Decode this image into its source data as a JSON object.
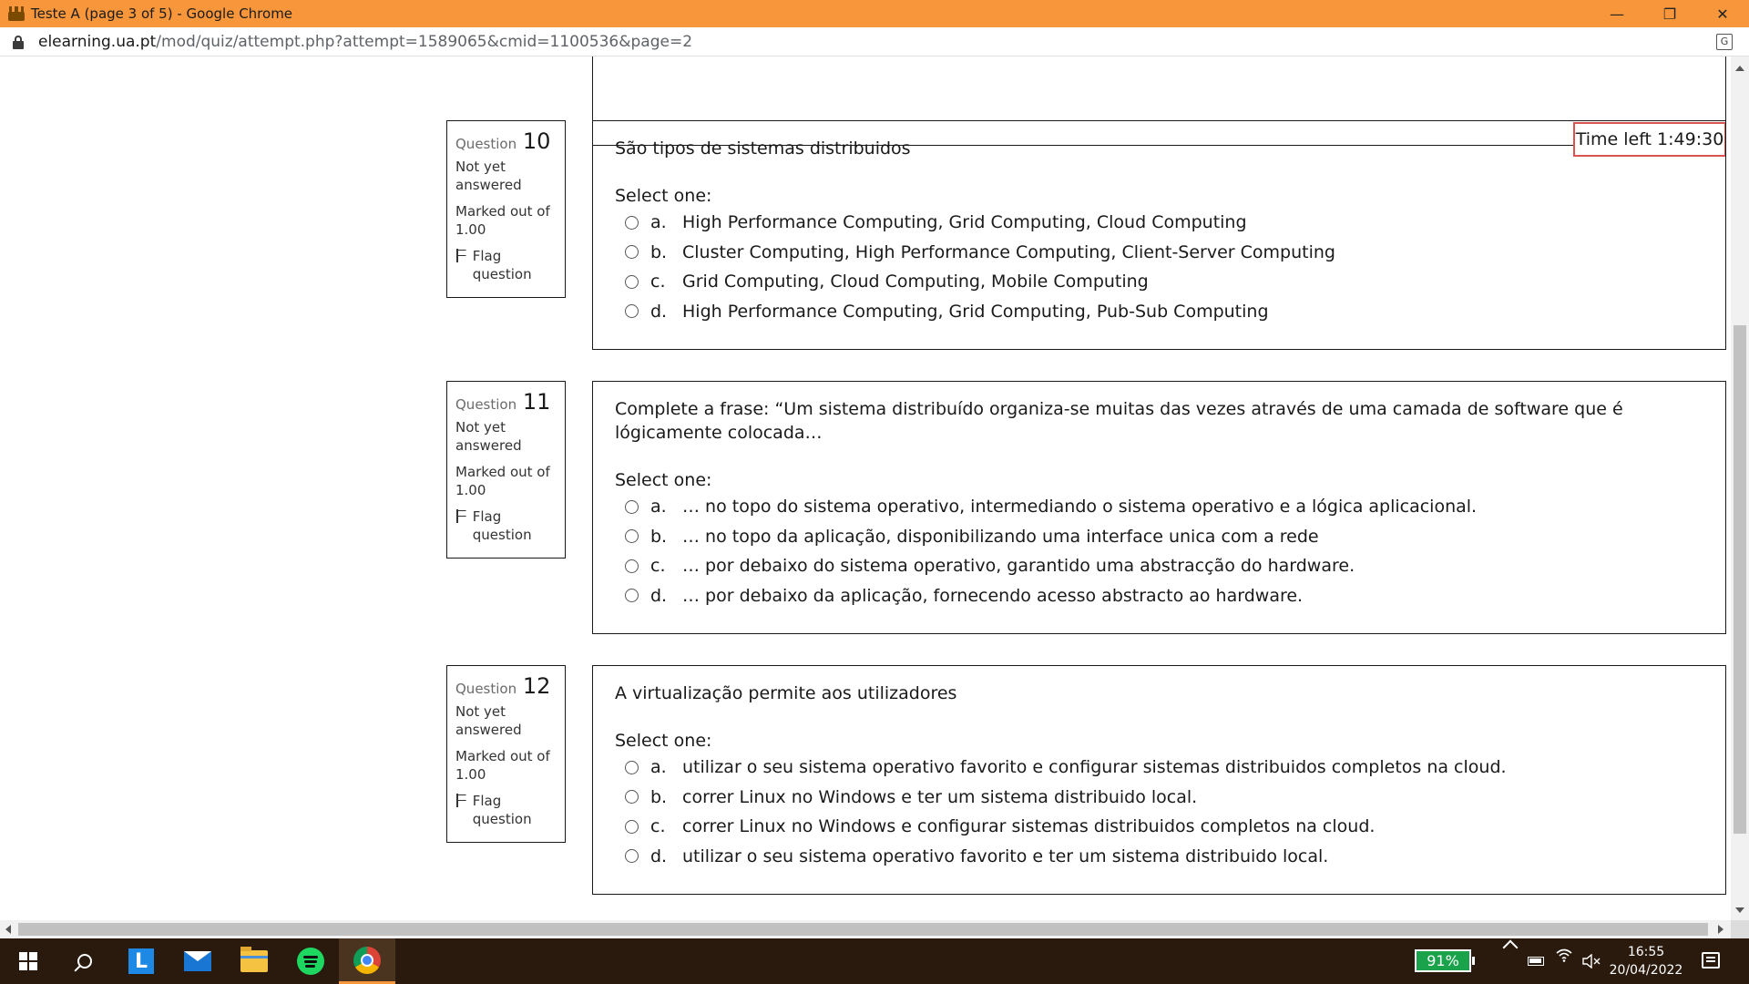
{
  "window": {
    "title": "Teste A (page 3 of 5) - Google Chrome",
    "controls": [
      "—",
      "❐",
      "✕"
    ]
  },
  "address": {
    "domain": "elearning.ua.pt",
    "path": "/mod/quiz/attempt.php?attempt=1589065&cmid=1100536&page=2"
  },
  "timer": "Time left 1:49:30",
  "labels": {
    "question": "Question",
    "not_yet_answered": "Not yet answered",
    "marked_out_of": "Marked out of 1.00",
    "flag_question": "Flag question",
    "select_one": "Select one:"
  },
  "questions": [
    {
      "number": "10",
      "text": "São tipos de sistemas distribuidos",
      "answers": [
        {
          "letter": "a.",
          "text": "High Performance Computing, Grid Computing, Cloud Computing"
        },
        {
          "letter": "b.",
          "text": "Cluster Computing, High Performance Computing, Client-Server Computing"
        },
        {
          "letter": "c.",
          "text": "Grid Computing, Cloud Computing, Mobile Computing"
        },
        {
          "letter": "d.",
          "text": "High Performance Computing, Grid Computing, Pub-Sub Computing"
        }
      ]
    },
    {
      "number": "11",
      "text": "Complete a frase: “Um sistema distribuído organiza-se muitas das vezes através de uma camada de software que é lógicamente colocada…",
      "answers": [
        {
          "letter": "a.",
          "text": "… no topo do sistema operativo, intermediando o sistema operativo e a lógica aplicacional."
        },
        {
          "letter": "b.",
          "text": "… no topo da aplicação, disponibilizando uma interface unica com a rede"
        },
        {
          "letter": "c.",
          "text": "… por debaixo do sistema operativo, garantido uma abstracção do hardware."
        },
        {
          "letter": "d.",
          "text": "… por debaixo da aplicação, fornecendo acesso abstracto ao hardware."
        }
      ]
    },
    {
      "number": "12",
      "text": "A virtualização permite aos utilizadores",
      "answers": [
        {
          "letter": "a.",
          "text": "utilizar o seu sistema operativo favorito e configurar sistemas distribuidos completos na cloud."
        },
        {
          "letter": "b.",
          "text": "correr Linux no Windows e ter um sistema distribuido local."
        },
        {
          "letter": "c.",
          "text": "correr Linux no Windows e configurar sistemas distribuidos completos na cloud."
        },
        {
          "letter": "d.",
          "text": "utilizar o seu sistema operativo favorito e ter um sistema distribuido local."
        }
      ]
    }
  ],
  "taskbar": {
    "apps": [
      "windows-start",
      "search",
      "l-app",
      "mail",
      "file-explorer",
      "spotify",
      "chrome"
    ],
    "active_app": "chrome",
    "battery_percent": "91%",
    "time": "16:55",
    "date": "20/04/2022"
  },
  "colors": {
    "titlebar": "#f7963a",
    "taskbar": "#2a1a0d",
    "timer_border": "#d9534f",
    "battery_badge": "#1aa34a"
  }
}
